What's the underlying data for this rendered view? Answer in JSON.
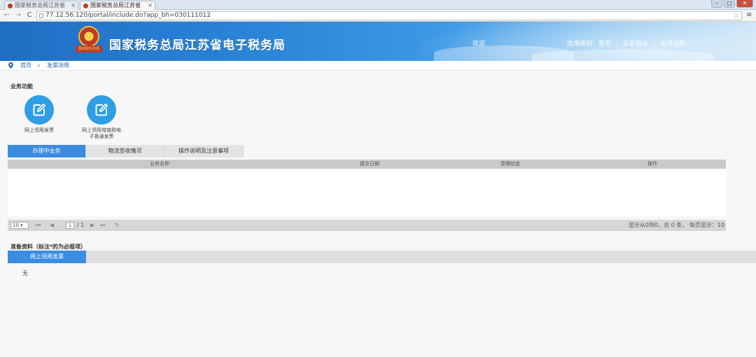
{
  "browser": {
    "tabs": [
      {
        "title": "国家税务总局江苏省"
      },
      {
        "title": "国家税务总局江苏省"
      }
    ],
    "close_glyph": "×",
    "url": "77.12.56.120/portal/include.do?app_bh=030111012",
    "window_controls": {
      "minimize": "–",
      "maximize": "□",
      "close": "✕"
    }
  },
  "header": {
    "site_title": "国家税务总局江苏省电子税务局",
    "emblem_ribbon": "国家税务总局",
    "welcome": "欢迎",
    "credit_label": "信用级别：",
    "credit_value": "暂无",
    "links": [
      "实名验证",
      "关闭当前"
    ],
    "separator": "|"
  },
  "breadcrumb": {
    "home": "首页",
    "arrow": "»",
    "current": "发票领用"
  },
  "business_functions": {
    "title": "业务功能",
    "items": [
      {
        "label": "网上领用发票"
      },
      {
        "label": "网上领用增值税电子普通发票"
      }
    ]
  },
  "tabs": [
    {
      "label": "办理中业务",
      "active": true
    },
    {
      "label": "物流签收情况",
      "active": false
    },
    {
      "label": "操作说明及注意事项",
      "active": false
    }
  ],
  "grid": {
    "columns": [
      "业务名称",
      "提交日期",
      "受理状态",
      "操作"
    ]
  },
  "pager": {
    "page_size": "10",
    "first": "⏮",
    "prev": "◀",
    "page": "1",
    "total_pages": "/ 1",
    "next": "▶",
    "last": "⏭",
    "refresh": "↻",
    "summary": "显示从0到0，总 0 条， 每页显示：10"
  },
  "materials": {
    "title": "准备资料（标注*的为必报项）",
    "tab": "网上领用发票",
    "content": "无"
  },
  "colors": {
    "accent": "#3b8be0",
    "icon_blue": "#2e9ee6",
    "header_blue": "#1e6fc4"
  }
}
